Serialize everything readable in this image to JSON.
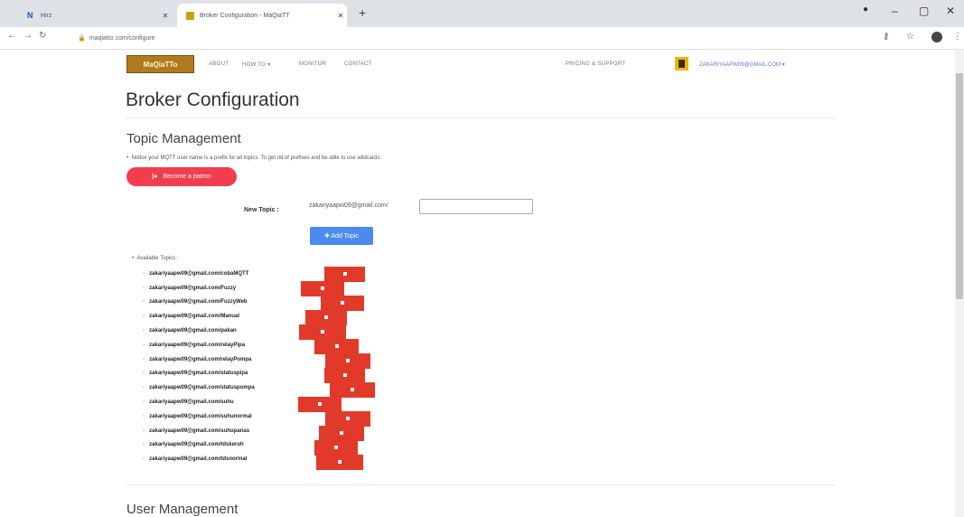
{
  "browser": {
    "tabs": [
      {
        "label": "Hirz",
        "favicon": "N"
      },
      {
        "label": "Broker Configuration - MaQiaTT",
        "favicon": ""
      }
    ],
    "url": "maqiatto.com/configure"
  },
  "site": {
    "brand": "MaQiaTTo",
    "nav": [
      "ABOUT",
      "HOW TO ▾",
      "MONITOR",
      "CONTACT"
    ],
    "pricing": "PRICING & SUPPORT",
    "user_email": "ZAKARIYAAPW09@GMAIL.COM ▾"
  },
  "page": {
    "title": "Broker Configuration",
    "topic_section": "Topic Management",
    "notice": "Notice your MQTT user name is a prefix for all topics. To get rid of prefixes and be able to use wildcards:",
    "patreon_button": "Become a patron",
    "new_topic_label": "New Topic :",
    "new_topic_prefix": "zakariyaapw09@gmail.com/",
    "new_topic_value": "",
    "add_topic_button": "✚ Add Topic",
    "available_label": "Available Topics :",
    "topics": [
      "zakariyaapw09@gmail.com/cobaMQTT",
      "zakariyaapw09@gmail.com/Fuzzy",
      "zakariyaapw09@gmail.com/FuzzyWeb",
      "zakariyaapw09@gmail.com/Manual",
      "zakariyaapw09@gmail.com/pakan",
      "zakariyaapw09@gmail.com/relayPipa",
      "zakariyaapw09@gmail.com/relayPompa",
      "zakariyaapw09@gmail.com/statuspipa",
      "zakariyaapw09@gmail.com/statuspompa",
      "zakariyaapw09@gmail.com/suhu",
      "zakariyaapw09@gmail.com/suhunormal",
      "zakariyaapw09@gmail.com/suhupanas",
      "zakariyaapw09@gmail.com/tdskeruh",
      "zakariyaapw09@gmail.com/tdsnormal"
    ],
    "user_section": "User Management"
  },
  "colors": {
    "accent": "#4b8bf0",
    "delete": "#e23a2a",
    "patreon": "#f23d4f",
    "brand": "#b07a1e"
  }
}
